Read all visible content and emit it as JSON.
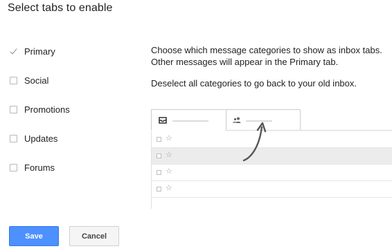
{
  "title": "Select tabs to enable",
  "categories": [
    {
      "label": "Primary",
      "checked": true
    },
    {
      "label": "Social",
      "checked": false
    },
    {
      "label": "Promotions",
      "checked": false
    },
    {
      "label": "Updates",
      "checked": false
    },
    {
      "label": "Forums",
      "checked": false
    }
  ],
  "description": {
    "line1": "Choose which message categories to show as inbox tabs.",
    "line2": "Other messages will appear in the Primary tab.",
    "line3": "Deselect all categories to go back to your old inbox."
  },
  "preview": {
    "tab1_icon": "inbox-icon",
    "tab2_icon": "people-icon",
    "row_icon": "star-icon",
    "star_glyph": "☆"
  },
  "buttons": {
    "save_label": "Save",
    "cancel_label": "Cancel"
  },
  "colors": {
    "save_bg": "#4d90fe",
    "cancel_bg": "#f5f5f5"
  }
}
